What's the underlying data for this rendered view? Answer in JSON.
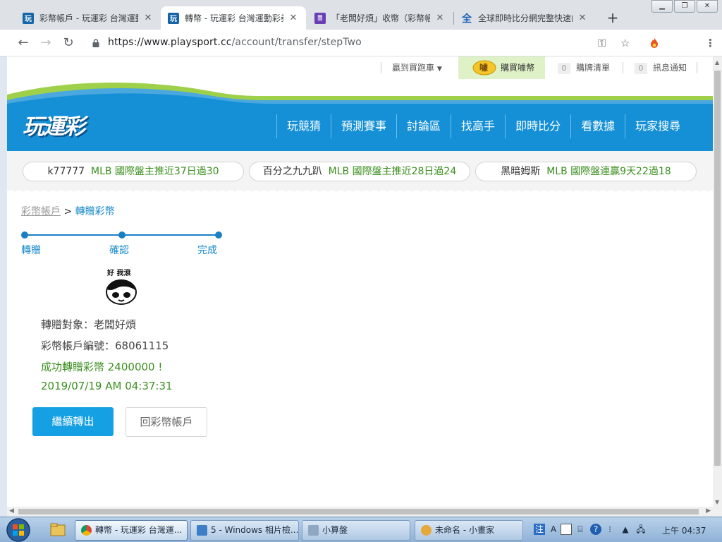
{
  "browser": {
    "tabs": [
      {
        "title": "彩幣帳戶 - 玩運彩 台灣運動",
        "favicon": "玩",
        "active": false
      },
      {
        "title": "轉幣 - 玩運彩 台灣運動彩券",
        "favicon": "玩",
        "active": true
      },
      {
        "title": "「老闆好煩」收幣（彩幣帳",
        "favicon": "list",
        "active": false
      },
      {
        "title": "全球即時比分網完整快速的",
        "favicon": "全",
        "active": false
      }
    ],
    "url_host": "https://www.playsport.cc",
    "url_path": "/account/transfer/stepTwo"
  },
  "site": {
    "topbar": {
      "cart": "贏到買跑車",
      "coins": "購買噱幣",
      "coins_icon": "噱",
      "watch_count": "0",
      "watch_label": "購牌清單",
      "notice_count": "0",
      "notice_label": "訊息通知"
    },
    "logo": "玩運彩",
    "nav": [
      "玩競猜",
      "預測賽事",
      "討論區",
      "找高手",
      "即時比分",
      "看數據",
      "玩家搜尋"
    ],
    "ticker": [
      {
        "name": "k77777",
        "text": "MLB 國際盤主推近37日過30"
      },
      {
        "name": "百分之九九趴",
        "text": "MLB 國際盤主推近28日過24"
      },
      {
        "name": "黑暗姆斯",
        "text": "MLB 國際盤連贏9天22過18"
      }
    ]
  },
  "content": {
    "breadcrumb_link": "彩幣帳戶",
    "breadcrumb_sep": ">",
    "breadcrumb_current": "轉贈彩幣",
    "steps": [
      "轉贈",
      "確認",
      "完成"
    ],
    "sticker_caption": "好 我滾",
    "recipient": "轉贈對象：老闆好煩",
    "account": "彩幣帳戶編號：68061115",
    "success": "成功轉贈彩幣 2400000 !",
    "datetime": "2019/07/19 AM 04:37:31",
    "btn_continue": "繼續轉出",
    "btn_back": "回彩幣帳戶"
  },
  "taskbar": {
    "tasks": [
      {
        "label": "轉幣 - 玩運彩 台灣運...",
        "active": true
      },
      {
        "label": "5 - Windows 相片檢...",
        "active": false
      },
      {
        "label": "小算盤",
        "active": false
      },
      {
        "label": "未命名 - 小畫家",
        "active": false
      }
    ],
    "clock": "上午 04:37"
  },
  "colors": {
    "brand_blue": "#1590d6",
    "accent_button": "#16a0e4",
    "success_green": "#3a8f1e",
    "link_blue": "#1589c9"
  }
}
